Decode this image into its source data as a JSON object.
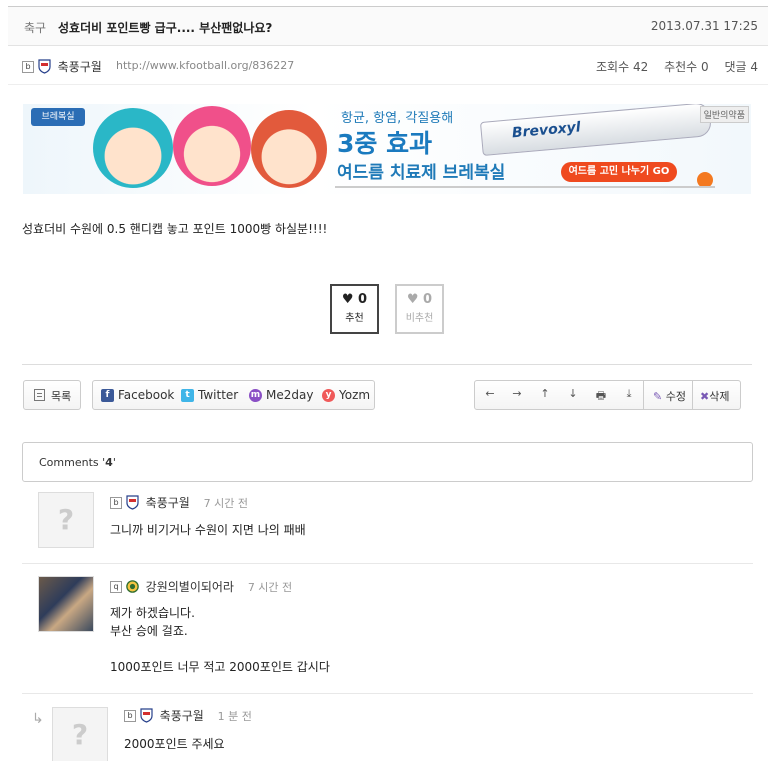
{
  "post": {
    "category": "축구",
    "title": "성효더비 포인트빵 급구.... 부산팬없나요?",
    "date": "2013.07.31 17:25",
    "author": "축풍구월",
    "author_level": "b",
    "url": "http://www.kfootball.org/836227",
    "views": "조회수 42",
    "recommends": "추천수 0",
    "comments_count": "댓글 4",
    "body": "성효더비 수원에 0.5 핸디캡 놓고 포인트 1000빵 하실분!!!!"
  },
  "ad": {
    "brand": "브레복실",
    "line1": "항균, 항염, 각질용해",
    "line2": "3중 효과",
    "line3": "여드름 치료제 브레복실",
    "product": "Brevoxyl",
    "cta": "여드름 고민 나누기 GO",
    "tag": "일반의약품"
  },
  "vote": {
    "up_count": "♥ 0",
    "up_label": "추천",
    "down_count": "♥ 0",
    "down_label": "비추천"
  },
  "actions": {
    "list": "목록",
    "facebook": "Facebook",
    "twitter": "Twitter",
    "me2day": "Me2day",
    "yozm": "Yozm",
    "prev": "←",
    "next": "→",
    "up": "↑",
    "down": "↓",
    "print": "🖶",
    "save": "⤓",
    "edit": "수정",
    "delete": "삭제"
  },
  "comments_header": {
    "prefix": "Comments '",
    "count": "4",
    "suffix": "'"
  },
  "comments": [
    {
      "level": "b",
      "author": "축풍구월",
      "time": "7 시간 전",
      "text": "그니까 비기거나 수원이 지면 나의 패배"
    },
    {
      "level": "q",
      "author": "강원의별이되어라",
      "time": "7 시간 전",
      "text": "제가 하겠습니다.\n부산 승에 걸죠.\n\n1000포인트 너무 적고 2000포인트 갑시다"
    },
    {
      "level": "b",
      "author": "축풍구월",
      "time": "1 분 전",
      "text": "2000포인트 주세요"
    }
  ]
}
